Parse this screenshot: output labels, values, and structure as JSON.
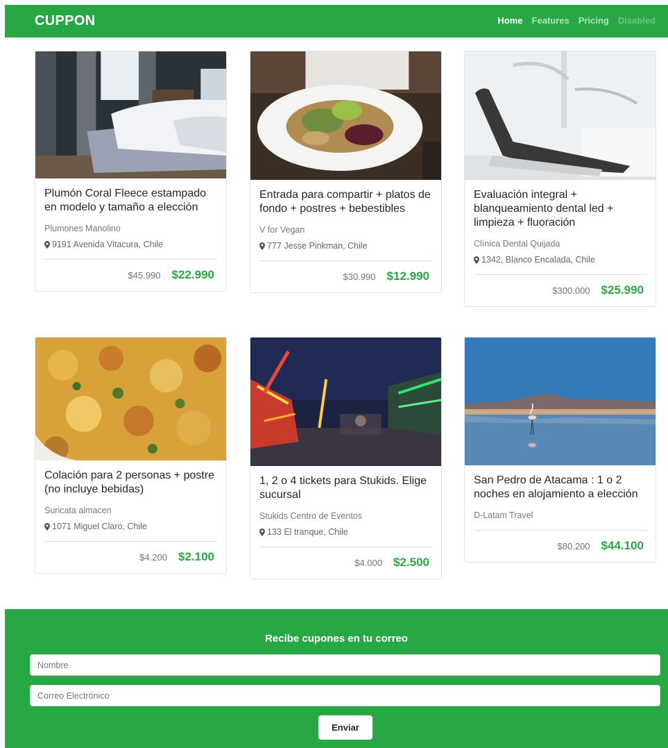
{
  "navbar": {
    "brand": "CUPPON",
    "links": [
      {
        "label": "Home"
      },
      {
        "label": "Features"
      },
      {
        "label": "Pricing"
      },
      {
        "label": "Disabled"
      }
    ]
  },
  "cards": [
    {
      "title": "Plumón Coral Fleece estampado en modelo y tamaño a elección",
      "vendor": "Plumones Manolino",
      "address": "9191 Avenida Vitacura, Chile",
      "old_price": "$45.990",
      "new_price": "$22.990"
    },
    {
      "title": "Entrada para compartir + platos de fondo + postres + bebestibles",
      "vendor": "V for Vegan",
      "address": "777 Jesse Pinkman, Chile",
      "old_price": "$30.990",
      "new_price": "$12.990"
    },
    {
      "title": "Evaluación integral + blanqueamiento dental led + limpieza + fluoración",
      "vendor": "Clínica Dental Quijada",
      "address": "1342, Blanco Encalada, Chile",
      "old_price": "$300.000",
      "new_price": "$25.990"
    },
    {
      "title": "Colación para 2 personas + postre (no incluye bebidas)",
      "vendor": "Suricata almacen",
      "address": "1071 Miguel Claro, Chile",
      "old_price": "$4.200",
      "new_price": "$2.100"
    },
    {
      "title": "1, 2 o 4 tickets para Stukids. Elige sucursal",
      "vendor": "Stukids Centro de Eventos",
      "address": "133 El tranque, Chile",
      "old_price": "$4.000",
      "new_price": "$2.500"
    },
    {
      "title": "San Pedro de Atacama : 1 o 2 noches en alojamiento a elección",
      "vendor": "D-Latam Travel",
      "old_price": "$80.200",
      "new_price": "$44.100"
    }
  ],
  "newsletter": {
    "title": "Recibe cupones en tu correo",
    "name_placeholder": "Nombre",
    "email_placeholder": "Correo Electrónico",
    "submit_label": "Enviar"
  },
  "colors": {
    "primary": "#28a745",
    "text": "#212529",
    "muted": "#6c757d"
  }
}
